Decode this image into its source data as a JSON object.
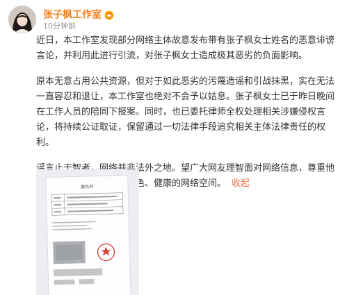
{
  "post": {
    "author": "张子枫工作室",
    "badge_icon": "vip-badge-icon",
    "time": "10分钟前",
    "paragraphs": [
      "近日，本工作室发现部分网络主体故意发布带有张子枫女士姓名的恶意诽谤言论，并利用此进行引流，对张子枫女士造成极其恶劣的负面影响。",
      "原本无意占用公共资源，但对于如此恶劣的污蔑造谣和引战抹黑，实在无法一直容忍和退让，本工作室也绝对不会予以姑息。张子枫女士已于昨日晚间在工作人员的陪同下报案。同时，也已委托律师全权处理相关涉嫌侵权言论，将持续公证取证，保留通过一切法律手段追究相关主体法律责任的权利。",
      "谣言止于智者，网络并非法外之地。望广大网友理智面对网络信息，尊重他人合法权益，共同营造绿色、健康的网络空间。"
    ],
    "collapse_label": "收起"
  },
  "attachment": {
    "doc_title": "委托书",
    "stamp_color": "#d2453a"
  }
}
